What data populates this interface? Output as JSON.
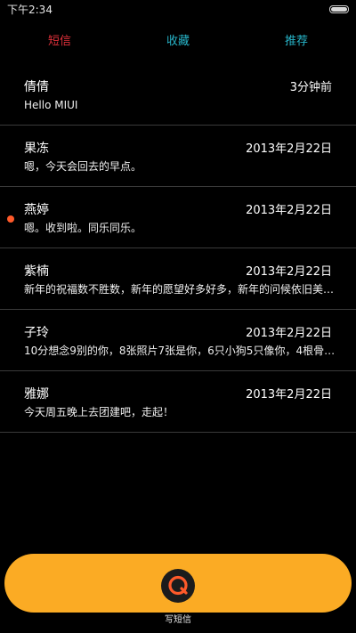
{
  "status_bar": {
    "time": "下午2:34",
    "battery_icon": "battery-icon"
  },
  "tabs": [
    {
      "label": "短信",
      "color": "#e0303a",
      "active": true
    },
    {
      "label": "收藏",
      "color": "#27b4c8",
      "active": false
    },
    {
      "label": "推荐",
      "color": "#27b4c8",
      "active": false
    }
  ],
  "messages": [
    {
      "name": "倩倩",
      "time": "3分钟前",
      "preview": "Hello MIUI",
      "unread": false
    },
    {
      "name": "果冻",
      "time": "2013年2月22日",
      "preview": "嗯，今天会回去的早点。",
      "unread": false
    },
    {
      "name": "燕婷",
      "time": "2013年2月22日",
      "preview": "嗯。收到啦。同乐同乐。",
      "unread": true
    },
    {
      "name": "紫楠",
      "time": "2013年2月22日",
      "preview": "新年的祝福数不胜数，新年的愿望好多好多，新年的问候依旧美好…",
      "unread": false
    },
    {
      "name": "子玲",
      "time": "2013年2月22日",
      "preview": "10分想念9别的你，8张照片7张是你，6只小狗5只像你，4根骨头…",
      "unread": false
    },
    {
      "name": "雅娜",
      "time": "2013年2月22日",
      "preview": "今天周五晚上去团建吧，走起！",
      "unread": false
    }
  ],
  "compose": {
    "label": "写短信",
    "icon": "compose-message-icon",
    "bar_color": "#fbab24",
    "unread_color": "#ff5a2a"
  }
}
